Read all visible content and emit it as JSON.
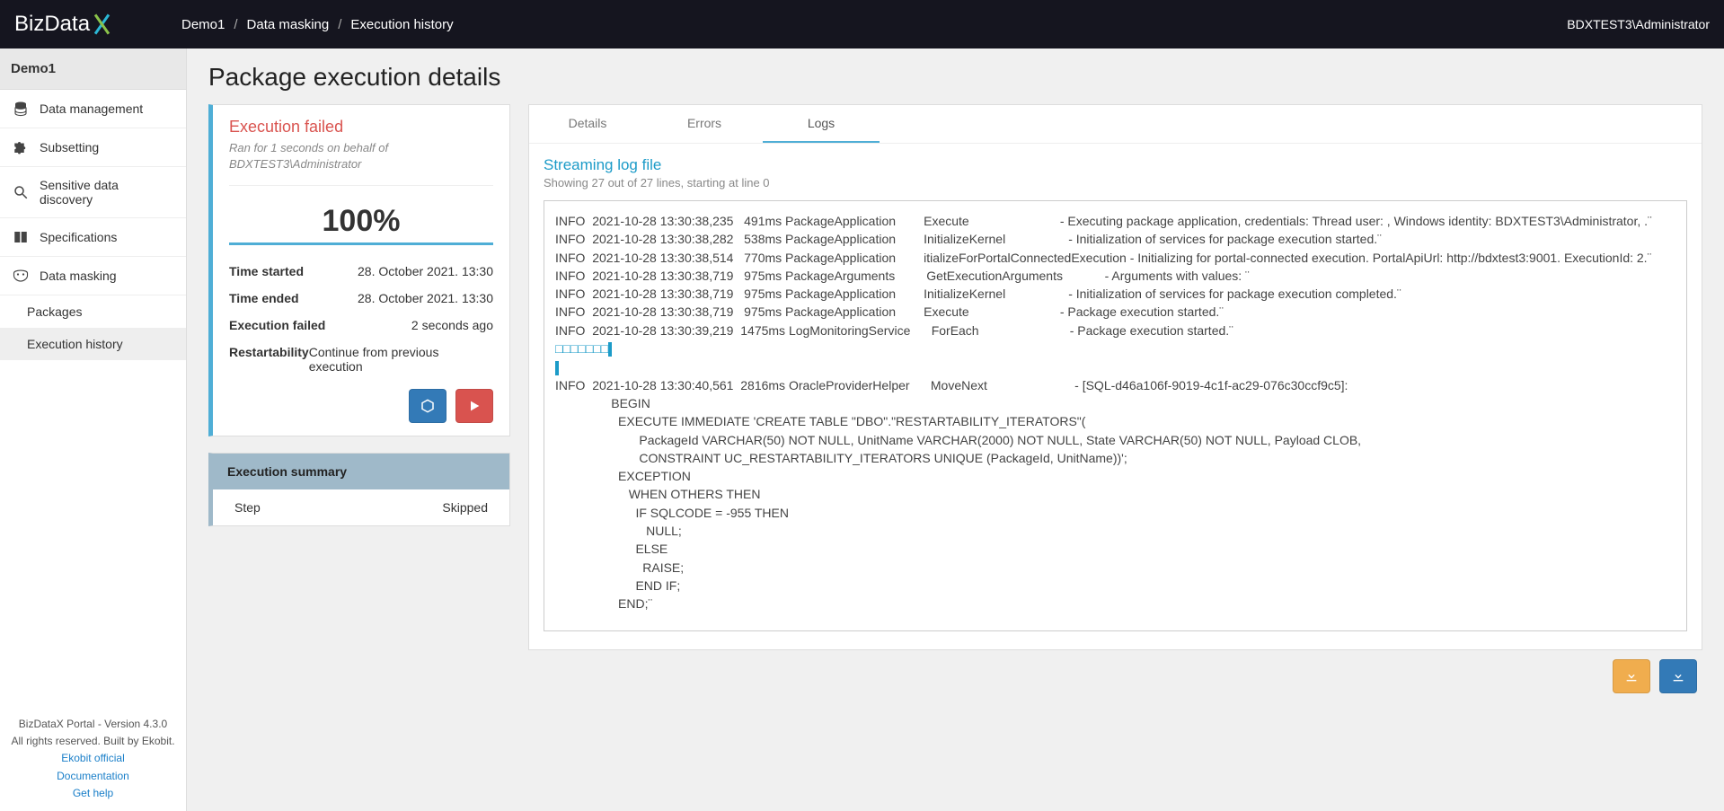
{
  "header": {
    "logo_text": "BizData",
    "breadcrumb": [
      "Demo1",
      "Data masking",
      "Execution history"
    ],
    "user": "BDXTEST3\\Administrator"
  },
  "sidebar": {
    "env": "Demo1",
    "items": [
      {
        "icon": "database",
        "label": "Data management"
      },
      {
        "icon": "puzzle",
        "label": "Subsetting"
      },
      {
        "icon": "search",
        "label": "Sensitive data discovery"
      },
      {
        "icon": "book",
        "label": "Specifications"
      },
      {
        "icon": "mask",
        "label": "Data masking"
      }
    ],
    "sub": [
      {
        "label": "Packages",
        "active": false
      },
      {
        "label": "Execution history",
        "active": true
      }
    ],
    "footer": {
      "l1": "BizDataX Portal - Version 4.3.0",
      "l2": "All rights reserved. Built by Ekobit.",
      "links": [
        "Ekobit official",
        "Documentation",
        "Get help"
      ]
    }
  },
  "page": {
    "title": "Package execution details"
  },
  "status": {
    "title": "Execution failed",
    "ran_for": "Ran for 1 seconds on behalf of",
    "on_behalf": "BDXTEST3\\Administrator",
    "progress": "100%",
    "rows": [
      {
        "k": "Time started",
        "v": "28. October 2021. 13:30"
      },
      {
        "k": "Time ended",
        "v": "28. October 2021. 13:30"
      },
      {
        "k": "Execution failed",
        "v": "2 seconds ago"
      },
      {
        "k": "Restartability",
        "v": "Continue from previous execution"
      }
    ],
    "action_icons": [
      "cube",
      "play"
    ]
  },
  "summary": {
    "header": "Execution summary",
    "cols": [
      "Step",
      "Skipped"
    ]
  },
  "tabs": {
    "items": [
      "Details",
      "Errors",
      "Logs"
    ],
    "active": 2,
    "logs": {
      "title": "Streaming log file",
      "subtitle_before": "Showing ",
      "count": "27",
      "sub_mid": " out of ",
      "total": "27",
      "sub_after": " lines, starting at line 0",
      "lines": [
        "INFO  2021-10-28 13:30:38,235   491ms PackageApplication        Execute                          - Executing package application, credentials: Thread user: , Windows identity: BDXTEST3\\Administrator, .¨",
        "INFO  2021-10-28 13:30:38,282   538ms PackageApplication        InitializeKernel                  - Initialization of services for package execution started.¨",
        "INFO  2021-10-28 13:30:38,514   770ms PackageApplication        itializeForPortalConnectedExecution - Initializing for portal-connected execution. PortalApiUrl: http://bdxtest3:9001. ExecutionId: 2.¨",
        "INFO  2021-10-28 13:30:38,719   975ms PackageArguments         GetExecutionArguments            - Arguments with values: ¨",
        "INFO  2021-10-28 13:30:38,719   975ms PackageApplication        InitializeKernel                  - Initialization of services for package execution completed.¨",
        "INFO  2021-10-28 13:30:38,719   975ms PackageApplication        Execute                          - Package execution started.¨",
        "INFO  2021-10-28 13:30:39,219  1475ms LogMonitoringService      ForEach                          - Package execution started.¨"
      ],
      "cursor_row": "□□□□□□□",
      "tail": [
        "INFO  2021-10-28 13:30:40,561  2816ms OracleProviderHelper      MoveNext                         - [SQL-d46a106f-9019-4c1f-ac29-076c30ccf9c5]:",
        "                BEGIN",
        "                  EXECUTE IMMEDIATE 'CREATE TABLE \"DBO\".\"RESTARTABILITY_ITERATORS\"(",
        "                        PackageId VARCHAR(50) NOT NULL, UnitName VARCHAR(2000) NOT NULL, State VARCHAR(50) NOT NULL, Payload CLOB,",
        "                        CONSTRAINT UC_RESTARTABILITY_ITERATORS UNIQUE (PackageId, UnitName))';",
        "                  EXCEPTION",
        "                     WHEN OTHERS THEN",
        "                       IF SQLCODE = -955 THEN",
        "                          NULL;",
        "                       ELSE",
        "                         RAISE;",
        "                       END IF;",
        "                  END;¨"
      ]
    }
  }
}
